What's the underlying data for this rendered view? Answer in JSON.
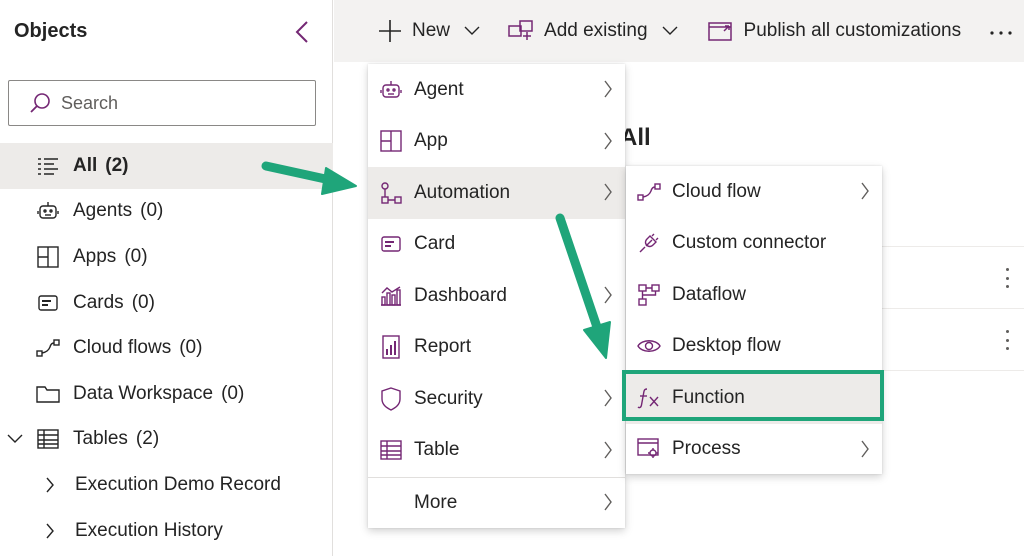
{
  "sidebar": {
    "title": "Objects",
    "search_placeholder": "Search",
    "items": [
      {
        "label": "All",
        "count": "(2)",
        "icon": "list-icon",
        "active": true
      },
      {
        "label": "Agents",
        "count": "(0)",
        "icon": "bot-icon"
      },
      {
        "label": "Apps",
        "count": "(0)",
        "icon": "apps-grid-icon"
      },
      {
        "label": "Cards",
        "count": "(0)",
        "icon": "card-icon"
      },
      {
        "label": "Cloud flows",
        "count": "(0)",
        "icon": "flow-icon"
      },
      {
        "label": "Data Workspace",
        "count": "(0)",
        "icon": "folder-icon"
      },
      {
        "label": "Tables",
        "count": "(2)",
        "icon": "table-icon",
        "expanded": true
      },
      {
        "label": "Execution Demo Record",
        "icon": "chevron-right-icon"
      },
      {
        "label": "Execution History",
        "icon": "chevron-right-icon"
      }
    ]
  },
  "toolbar": {
    "new_label": "New",
    "add_existing_label": "Add existing",
    "publish_label": "Publish all customizations",
    "more_icon": "more-horizontal-icon"
  },
  "main": {
    "title": "All"
  },
  "new_menu": {
    "items": [
      "Agent",
      "App",
      "Automation",
      "Card",
      "Dashboard",
      "Report",
      "Security",
      "Table",
      "More"
    ],
    "hovered": "Automation"
  },
  "automation_menu": {
    "items": [
      "Cloud flow",
      "Custom connector",
      "Dataflow",
      "Desktop flow",
      "Function",
      "Process"
    ],
    "highlighted": "Function"
  },
  "colors": {
    "accent": "#742774",
    "highlight": "#1fa57a",
    "hover_bg": "#edebe9",
    "toolbar_bg": "#f3f2f1"
  }
}
